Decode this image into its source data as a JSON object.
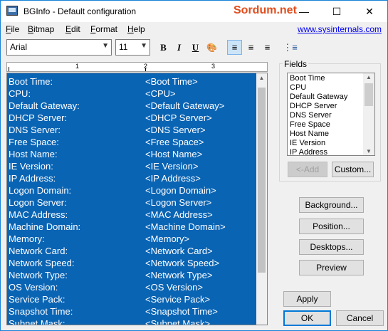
{
  "window": {
    "title": "BGInfo - Default configuration",
    "watermark": "Sordum.net",
    "minimize_glyph": "—",
    "maximize_glyph": "☐",
    "close_glyph": "✕"
  },
  "menu": {
    "items": [
      "File",
      "Bitmap",
      "Edit",
      "Format",
      "Help"
    ],
    "link": "www.sysinternals.com"
  },
  "toolbar": {
    "font_name": "Arial",
    "font_size": "11",
    "bold_label": "B",
    "italic_label": "I",
    "underline_label": "U",
    "color_label": "🎨",
    "align_left_label": "≡",
    "align_center_label": "≡",
    "align_right_label": "≡",
    "bullets_label": "⋮≡"
  },
  "ruler": {
    "numbers": [
      "1",
      "2",
      "3"
    ]
  },
  "editor": {
    "selection_color": "#0a64b4",
    "rows": [
      {
        "label": "Boot Time:",
        "value": "<Boot Time>"
      },
      {
        "label": "CPU:",
        "value": "<CPU>"
      },
      {
        "label": "Default Gateway:",
        "value": "<Default Gateway>"
      },
      {
        "label": "DHCP Server:",
        "value": "<DHCP Server>"
      },
      {
        "label": "DNS Server:",
        "value": "<DNS Server>"
      },
      {
        "label": "Free Space:",
        "value": "<Free Space>"
      },
      {
        "label": "Host Name:",
        "value": "<Host Name>"
      },
      {
        "label": "IE Version:",
        "value": "<IE Version>"
      },
      {
        "label": "IP Address:",
        "value": "<IP Address>"
      },
      {
        "label": "Logon Domain:",
        "value": "<Logon Domain>"
      },
      {
        "label": "Logon Server:",
        "value": "<Logon Server>"
      },
      {
        "label": "MAC Address:",
        "value": "<MAC Address>"
      },
      {
        "label": "Machine Domain:",
        "value": "<Machine Domain>"
      },
      {
        "label": "Memory:",
        "value": "<Memory>"
      },
      {
        "label": "Network Card:",
        "value": "<Network Card>"
      },
      {
        "label": "Network Speed:",
        "value": "<Network Speed>"
      },
      {
        "label": "Network Type:",
        "value": "<Network Type>"
      },
      {
        "label": "OS Version:",
        "value": "<OS Version>"
      },
      {
        "label": "Service Pack:",
        "value": "<Service Pack>"
      },
      {
        "label": "Snapshot Time:",
        "value": "<Snapshot Time>"
      },
      {
        "label": "Subnet Mask:",
        "value": "<Subnet Mask>"
      }
    ]
  },
  "fields": {
    "title": "Fields",
    "items": [
      "Boot Time",
      "CPU",
      "Default Gateway",
      "DHCP Server",
      "DNS Server",
      "Free Space",
      "Host Name",
      "IE Version",
      "IP Address"
    ],
    "add_label": "<-Add",
    "custom_label": "Custom..."
  },
  "buttons": {
    "background": "Background...",
    "position": "Position...",
    "desktops": "Desktops...",
    "preview": "Preview",
    "apply": "Apply",
    "ok": "OK",
    "cancel": "Cancel"
  }
}
